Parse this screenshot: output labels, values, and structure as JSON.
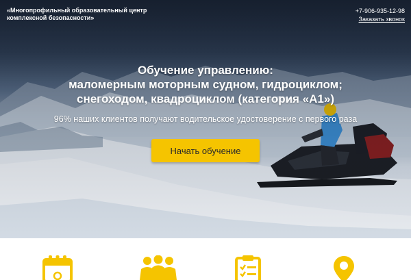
{
  "header": {
    "org_line1": "«Многопрофильный образовательный центр",
    "org_line2": "комплексной безопасности»",
    "phone": "+7-906-935-12-98",
    "callback_label": "Заказать звонок"
  },
  "hero": {
    "title_line1": "Обучение управлению:",
    "title_line2": "маломерным моторным судном, гидроциклом;",
    "title_line3": "снегоходом, квадроциклом (категория «А1»)",
    "subtitle": "96% наших клиентов получают водительское удостоверение с первого раза",
    "cta_label": "Начать обучение"
  },
  "features": {
    "icons": [
      "calendar-icon",
      "group-icon",
      "clipboard-checklist-icon",
      "location-pin-icon"
    ],
    "accent": "#f5c400"
  },
  "colors": {
    "accent": "#f5c400",
    "text_light": "#ffffff",
    "sky_dark": "#1f2b3d"
  }
}
